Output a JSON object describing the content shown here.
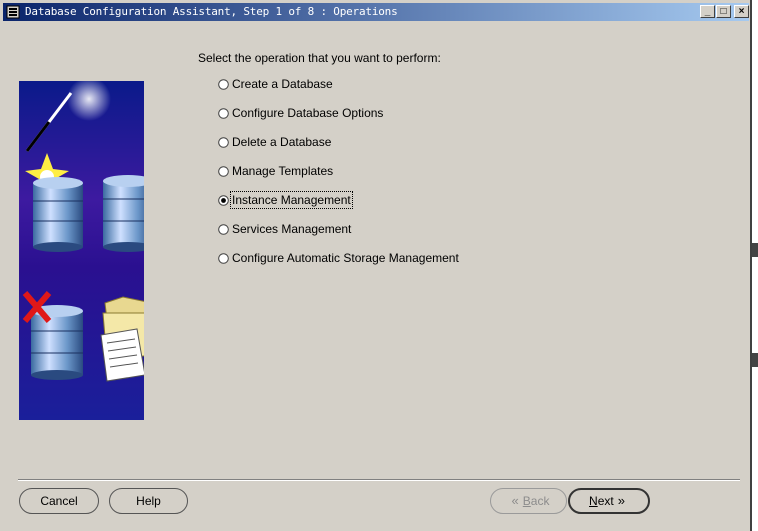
{
  "window": {
    "title": "Database Configuration Assistant, Step 1 of 8 : Operations",
    "controls": {
      "minimize": "_",
      "maximize": "□",
      "close": "×"
    }
  },
  "main": {
    "prompt": "Select the operation that you want to perform:",
    "options": [
      {
        "label": "Create a Database",
        "selected": false
      },
      {
        "label": "Configure Database Options",
        "selected": false
      },
      {
        "label": "Delete a Database",
        "selected": false
      },
      {
        "label": "Manage Templates",
        "selected": false
      },
      {
        "label": "Instance Management",
        "selected": true
      },
      {
        "label": "Services Management",
        "selected": false
      },
      {
        "label": "Configure Automatic Storage Management",
        "selected": false
      }
    ]
  },
  "footer": {
    "cancel": "Cancel",
    "help": "Help",
    "back": {
      "accelerator": "B",
      "rest": "ack"
    },
    "next": {
      "accelerator": "N",
      "rest": "ext"
    }
  },
  "art": {
    "icons": [
      "magic-wand-icon",
      "sparkle-icon",
      "database-icon",
      "checkbox-icon",
      "delete-x-icon",
      "folder-icon",
      "document-icon"
    ]
  }
}
